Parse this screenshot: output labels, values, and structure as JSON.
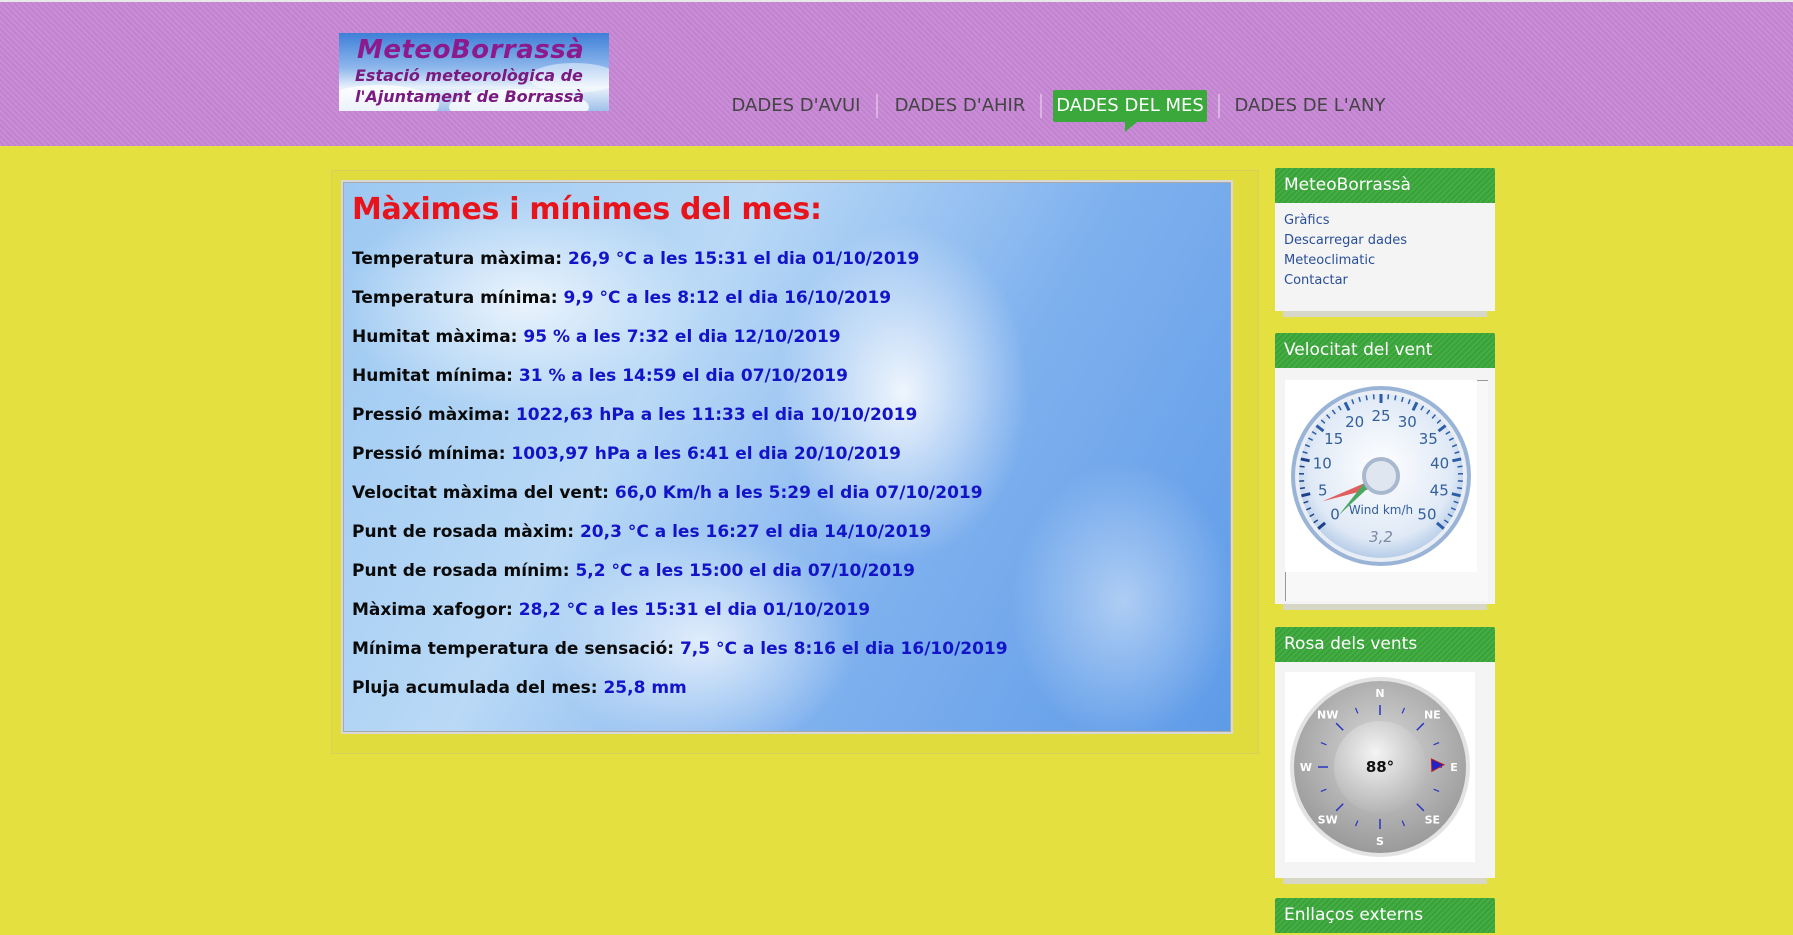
{
  "logo": {
    "line1": "MeteoBorrassà",
    "line2": "Estació meteorològica de",
    "line3": "l'Ajuntament de Borrassà"
  },
  "nav": [
    {
      "label": "DADES D'AVUI"
    },
    {
      "label": "DADES D'AHIR"
    },
    {
      "label": "DADES DEL MES"
    },
    {
      "label": "DADES DE L'ANY"
    }
  ],
  "nav_active": "DADES DEL MES",
  "main": {
    "title": "Màximes i mínimes del mes:",
    "rows": [
      {
        "label": "Temperatura màxima:",
        "value": "26,9 °C a les 15:31 el dia 01/10/2019"
      },
      {
        "label": "Temperatura mínima:",
        "value": "9,9 °C a les 8:12 el dia 16/10/2019"
      },
      {
        "label": "Humitat màxima:",
        "value": "95 % a les 7:32 el dia 12/10/2019"
      },
      {
        "label": "Humitat mínima:",
        "value": "31 % a les 14:59 el dia 07/10/2019"
      },
      {
        "label": "Pressió màxima:",
        "value": "1022,63 hPa a les 11:33 el dia 10/10/2019"
      },
      {
        "label": "Pressió mínima:",
        "value": "1003,97 hPa a les 6:41 el dia 20/10/2019"
      },
      {
        "label": "Velocitat màxima del vent:",
        "value": "66,0 Km/h a les 5:29 el dia 07/10/2019"
      },
      {
        "label": "Punt de rosada màxim:",
        "value": "20,3 °C a les 16:27 el dia 14/10/2019"
      },
      {
        "label": "Punt de rosada mínim:",
        "value": "5,2 °C a les 15:00 el dia 07/10/2019"
      },
      {
        "label": "Màxima xafogor:",
        "value": "28,2 °C a les 15:31 el dia 01/10/2019"
      },
      {
        "label": "Mínima temperatura de sensació:",
        "value": "7,5 °C a les 8:16 el dia 16/10/2019"
      },
      {
        "label": "Pluja acumulada del mes:",
        "value": "25,8 mm"
      }
    ]
  },
  "sidebar": {
    "box1": {
      "title": "MeteoBorrassà",
      "links": [
        "Gràfics",
        "Descarregar dades",
        "Meteoclimatic",
        "Contactar"
      ]
    },
    "box2": {
      "title": "Velocitat del vent",
      "gauge": {
        "label": "Wind km/h",
        "value": 3.2,
        "readout": "3,2",
        "max": 50,
        "ticks": [
          "0",
          "5",
          "10",
          "15",
          "20",
          "25",
          "30",
          "35",
          "40",
          "45",
          "50"
        ]
      }
    },
    "box3": {
      "title": "Rosa dels vents",
      "compass": {
        "direction_deg": 88,
        "readout": "88°",
        "labels": [
          "N",
          "NE",
          "E",
          "SE",
          "S",
          "SW",
          "W",
          "NW"
        ]
      }
    },
    "box4": {
      "title": "Enllaços externs"
    }
  },
  "colors": {
    "header_bg": "#c787d5",
    "page_bg": "#e4e040",
    "accent_green": "#3aa83a",
    "title_red": "#e8141c",
    "value_blue": "#1313c8"
  }
}
